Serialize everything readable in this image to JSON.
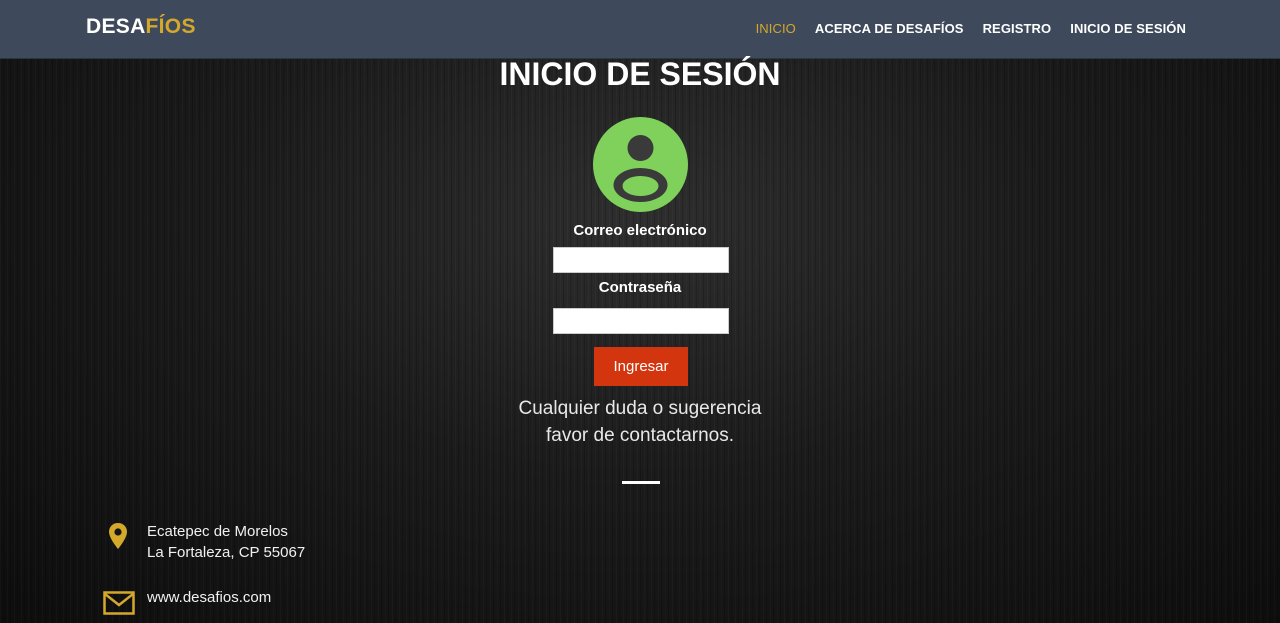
{
  "brand": {
    "part1": "DESA",
    "part2": "FÍOS"
  },
  "nav": {
    "items": [
      {
        "label": "INICIO",
        "active": true
      },
      {
        "label": "ACERCA DE DESAFÍOS"
      },
      {
        "label": "REGISTRO"
      },
      {
        "label": "INICIO DE SESIÓN"
      }
    ]
  },
  "login": {
    "title": "INICIO DE SESIÓN",
    "avatar_icon": "user-icon",
    "email_label": "Correo electrónico",
    "email_value": "",
    "password_label": "Contraseña",
    "password_value": "",
    "submit_label": "Ingresar"
  },
  "help": {
    "line1": "Cualquier duda o sugerencia",
    "line2": "favor de contactarnos."
  },
  "contact": {
    "address_line1": "Ecatepec de Morelos",
    "address_line2": "La Fortaleza, CP 55067",
    "website": "www.desafios.com",
    "location_icon": "location-pin-icon",
    "mail_icon": "mail-icon"
  },
  "colors": {
    "navbar": "#3e4a5c",
    "accent_gold": "#d4a82a",
    "avatar_green": "#7fd15b",
    "button_red": "#d3350f"
  }
}
